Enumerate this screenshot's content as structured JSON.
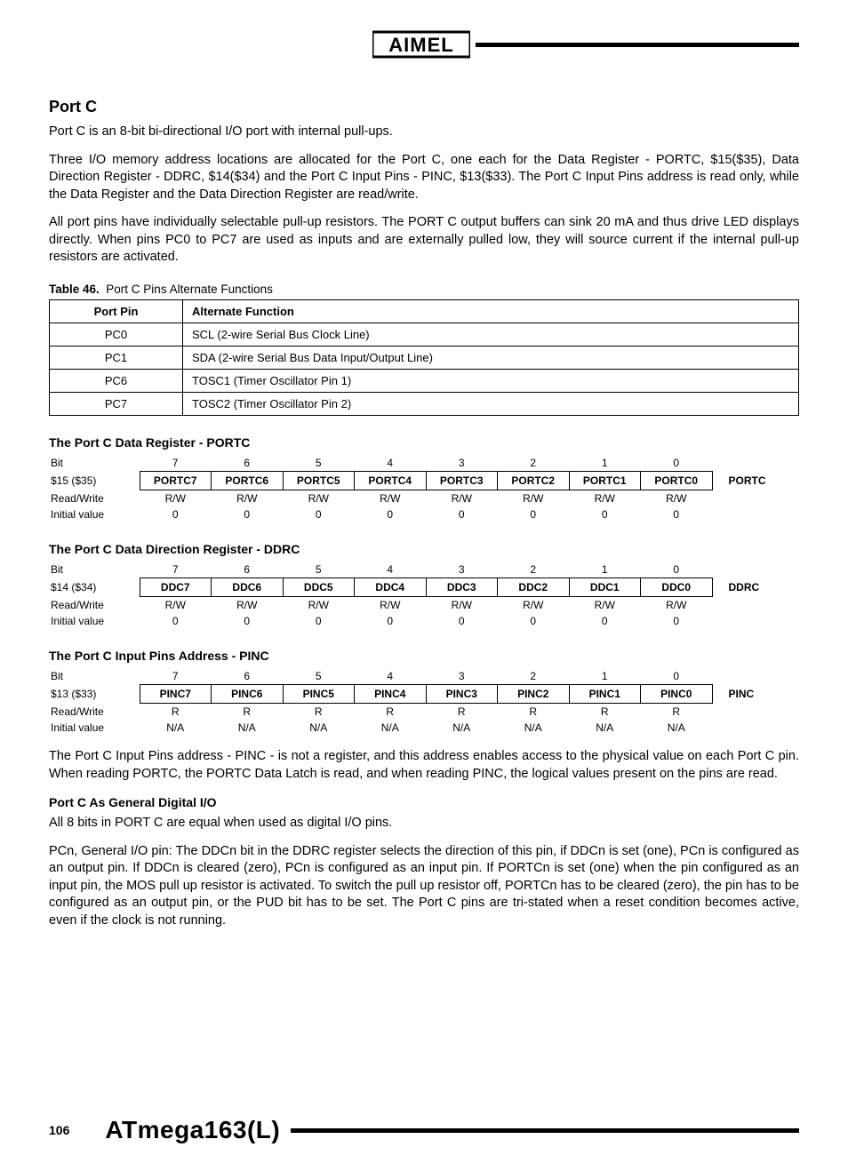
{
  "header": {
    "brand": "ATMEL"
  },
  "section": {
    "title": "Port C",
    "p1": "Port C is an 8-bit bi-directional I/O port with internal pull-ups.",
    "p2": "Three I/O memory address locations are allocated for the Port C, one each for the Data Register - PORTC, $15($35), Data Direction Register - DDRC, $14($34) and the Port C Input Pins - PINC, $13($33). The Port C Input Pins address is read only, while the Data Register and the Data Direction Register are read/write.",
    "p3": "All port pins have individually selectable pull-up resistors. The PORT C output buffers can sink 20 mA and thus drive LED displays directly. When pins PC0 to PC7 are used as inputs and are externally pulled low, they will source current if the internal pull-up resistors are activated."
  },
  "table46": {
    "caption_label": "Table 46.",
    "caption_text": "Port C Pins Alternate Functions",
    "headers": [
      "Port Pin",
      "Alternate Function"
    ],
    "rows": [
      [
        "PC0",
        "SCL (2-wire Serial Bus Clock Line)"
      ],
      [
        "PC1",
        "SDA (2-wire Serial Bus Data Input/Output Line)"
      ],
      [
        "PC6",
        "TOSC1 (Timer Oscillator Pin 1)"
      ],
      [
        "PC7",
        "TOSC2 (Timer Oscillator Pin 2)"
      ]
    ]
  },
  "reg_portc": {
    "title": "The Port C Data Register - PORTC",
    "addr": "$15 ($35)",
    "name": "PORTC",
    "bit_nums": [
      "7",
      "6",
      "5",
      "4",
      "3",
      "2",
      "1",
      "0"
    ],
    "bits": [
      "PORTC7",
      "PORTC6",
      "PORTC5",
      "PORTC4",
      "PORTC3",
      "PORTC2",
      "PORTC1",
      "PORTC0"
    ],
    "rw": [
      "R/W",
      "R/W",
      "R/W",
      "R/W",
      "R/W",
      "R/W",
      "R/W",
      "R/W"
    ],
    "init": [
      "0",
      "0",
      "0",
      "0",
      "0",
      "0",
      "0",
      "0"
    ],
    "row_labels": {
      "bit": "Bit",
      "rw": "Read/Write",
      "init": "Initial value"
    }
  },
  "reg_ddrc": {
    "title": "The Port C Data Direction Register - DDRC",
    "addr": "$14 ($34)",
    "name": "DDRC",
    "bit_nums": [
      "7",
      "6",
      "5",
      "4",
      "3",
      "2",
      "1",
      "0"
    ],
    "bits": [
      "DDC7",
      "DDC6",
      "DDC5",
      "DDC4",
      "DDC3",
      "DDC2",
      "DDC1",
      "DDC0"
    ],
    "rw": [
      "R/W",
      "R/W",
      "R/W",
      "R/W",
      "R/W",
      "R/W",
      "R/W",
      "R/W"
    ],
    "init": [
      "0",
      "0",
      "0",
      "0",
      "0",
      "0",
      "0",
      "0"
    ],
    "row_labels": {
      "bit": "Bit",
      "rw": "Read/Write",
      "init": "Initial value"
    }
  },
  "reg_pinc": {
    "title": "The Port C Input Pins Address - PINC",
    "addr": "$13 ($33)",
    "name": "PINC",
    "bit_nums": [
      "7",
      "6",
      "5",
      "4",
      "3",
      "2",
      "1",
      "0"
    ],
    "bits": [
      "PINC7",
      "PINC6",
      "PINC5",
      "PINC4",
      "PINC3",
      "PINC2",
      "PINC1",
      "PINC0"
    ],
    "rw": [
      "R",
      "R",
      "R",
      "R",
      "R",
      "R",
      "R",
      "R"
    ],
    "init": [
      "N/A",
      "N/A",
      "N/A",
      "N/A",
      "N/A",
      "N/A",
      "N/A",
      "N/A"
    ],
    "row_labels": {
      "bit": "Bit",
      "rw": "Read/Write",
      "init": "Initial value"
    }
  },
  "post": {
    "p1": "The Port C Input Pins address - PINC - is not a register, and this address enables access to the physical value on each Port C pin. When reading PORTC, the PORTC Data Latch is read, and when reading PINC, the logical values present on the pins are read.",
    "sub_title": "Port C As General Digital I/O",
    "p2": "All 8 bits in PORT C are equal when used as digital I/O pins.",
    "p3": "PCn, General I/O pin: The DDCn bit in the DDRC register selects the direction of this pin, if DDCn is set (one), PCn is configured as an output pin. If DDCn is cleared (zero), PCn is configured as an input pin. If PORTCn is set (one) when the pin configured as an input pin, the MOS pull up resistor is activated. To switch the pull up resistor off, PORTCn has to be cleared (zero), the pin has to be configured as an output pin, or the PUD bit has to be set. The Port C pins are tri-stated when a reset condition becomes active, even if the clock is not running."
  },
  "footer": {
    "page": "106",
    "product": "ATmega163(L)"
  }
}
